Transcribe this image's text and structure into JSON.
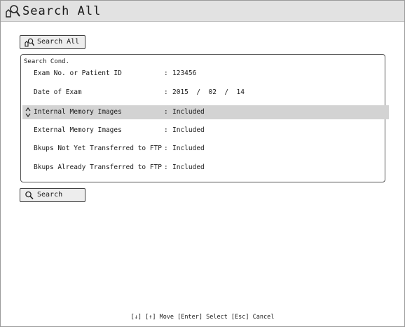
{
  "window": {
    "title": "Search All"
  },
  "top_button": {
    "label": "Search All",
    "icon": "search-all-icon"
  },
  "search_cond": {
    "title": "Search Cond.",
    "rows": [
      {
        "label": "Exam No. or Patient ID",
        "sep": ":",
        "value": "123456"
      },
      {
        "label": "Date of Exam",
        "sep": ":",
        "value": "2015  /  02  /  14"
      },
      {
        "label": "Internal Memory Images",
        "sep": ":",
        "value": "Included",
        "selected": true
      },
      {
        "label": "External Memory Images",
        "sep": ":",
        "value": "Included"
      },
      {
        "label": "Bkups Not Yet Transferred to FTP",
        "sep": ":",
        "value": "Included"
      },
      {
        "label": "Bkups Already Transferred to FTP",
        "sep": ":",
        "value": "Included"
      }
    ]
  },
  "search_button": {
    "label": "Search",
    "icon": "magnifier-icon"
  },
  "footer": {
    "hint": "[↓] [↑] Move  [Enter] Select  [Esc] Cancel"
  },
  "colors": {
    "titlebar": "#e2e2e2",
    "selected_row": "#d3d3d3",
    "button": "#ededed"
  }
}
